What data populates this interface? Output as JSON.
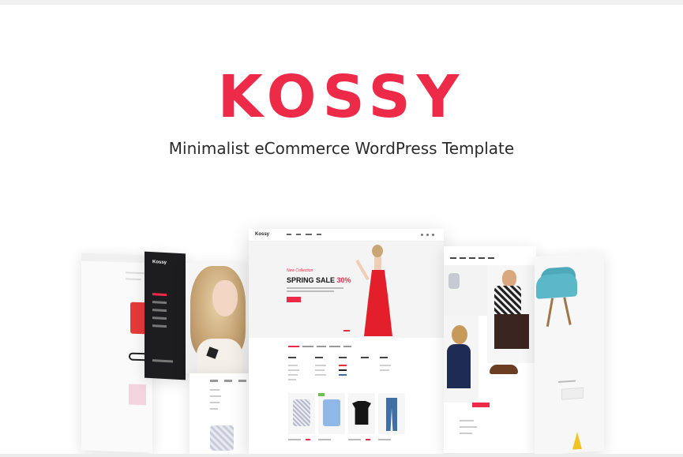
{
  "brand": {
    "name": "KOSSY",
    "tagline": "Minimalist eCommerce WordPress Template",
    "accent_color": "#ee2a49"
  },
  "preview": {
    "center_logo": "Kossy",
    "sidebar_logo": "Kossy",
    "hero_collection": "New Collection",
    "hero_title": "SPRING SALE",
    "hero_discount": "30%"
  }
}
